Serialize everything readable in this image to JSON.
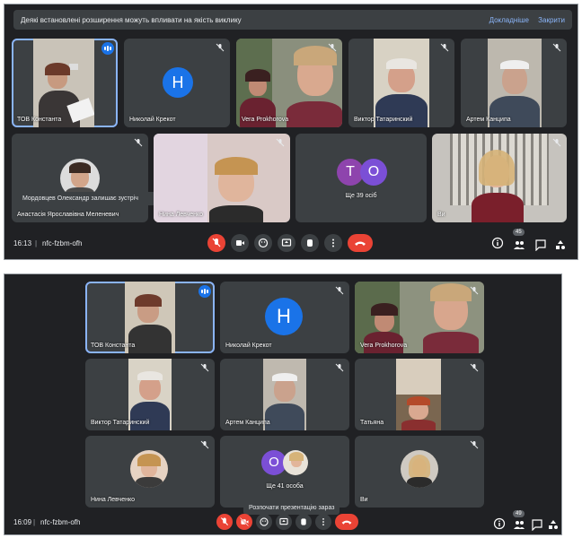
{
  "screenshot_top": {
    "banner": {
      "message": "Деякі встановлені розширення можуть впливати на якість виклику",
      "more_link": "Докладніше",
      "close_link": "Закрити"
    },
    "participants": [
      {
        "name": "ТОВ Константа"
      },
      {
        "name": "Николай Крекот",
        "initial": "Н"
      },
      {
        "name": "Vera Prokhorova"
      },
      {
        "name": "Виктор Татаринский"
      },
      {
        "name": "Артем Канципа"
      },
      {
        "name": "Анастасія Ярославівна Меленевич"
      },
      {
        "name": "Нина Левченко"
      },
      {
        "name": "Ще 39 осіб",
        "initials": [
          "Т",
          "О"
        ]
      },
      {
        "name": "Ви"
      }
    ],
    "notification": "Мордовцев Олександр залишає зустріч",
    "time": "16:13",
    "meeting_code": "nfc-fzbm-ofh",
    "people_count": "45"
  },
  "screenshot_bottom": {
    "participants": [
      {
        "name": "ТОВ Константа"
      },
      {
        "name": "Николай Крекот",
        "initial": "Н"
      },
      {
        "name": "Vera Prokhorova"
      },
      {
        "name": "Виктор Татаринский"
      },
      {
        "name": "Артем Канципа"
      },
      {
        "name": "Татьяна"
      },
      {
        "name": "Нина Левченко"
      },
      {
        "name": "Ще 41 особа",
        "initial": "О"
      },
      {
        "name": "Ви"
      }
    ],
    "tooltip": "Розпочати презентацію зараз",
    "time": "16:09",
    "meeting_code": "nfc-fzbm-ofh",
    "people_count": "49"
  },
  "colors": {
    "background": "#202124",
    "tile": "#3c4043",
    "accent": "#8ab4f8",
    "danger": "#ea4335",
    "avatar_blue": "#1a73e8",
    "avatar_purple": "#8e44ad",
    "avatar_violet": "#7b4fd6"
  },
  "icons": [
    "mic-off-icon",
    "camera-icon",
    "emoji-icon",
    "present-icon",
    "raise-hand-icon",
    "more-options-icon",
    "hang-up-icon",
    "info-icon",
    "people-icon",
    "chat-icon",
    "activities-icon",
    "speaking-icon"
  ]
}
